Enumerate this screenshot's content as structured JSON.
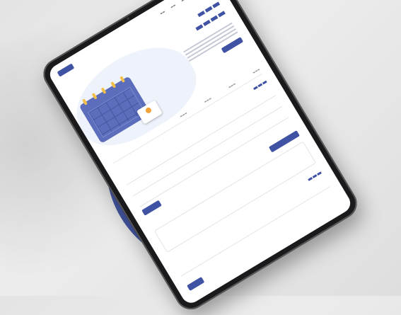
{
  "colors": {
    "accent": "#3f52a3",
    "circle": "#4557a3",
    "background": "#e6e6e6"
  },
  "icons": {
    "calendar": "calendar-illustration",
    "clock": "clock-icon"
  }
}
